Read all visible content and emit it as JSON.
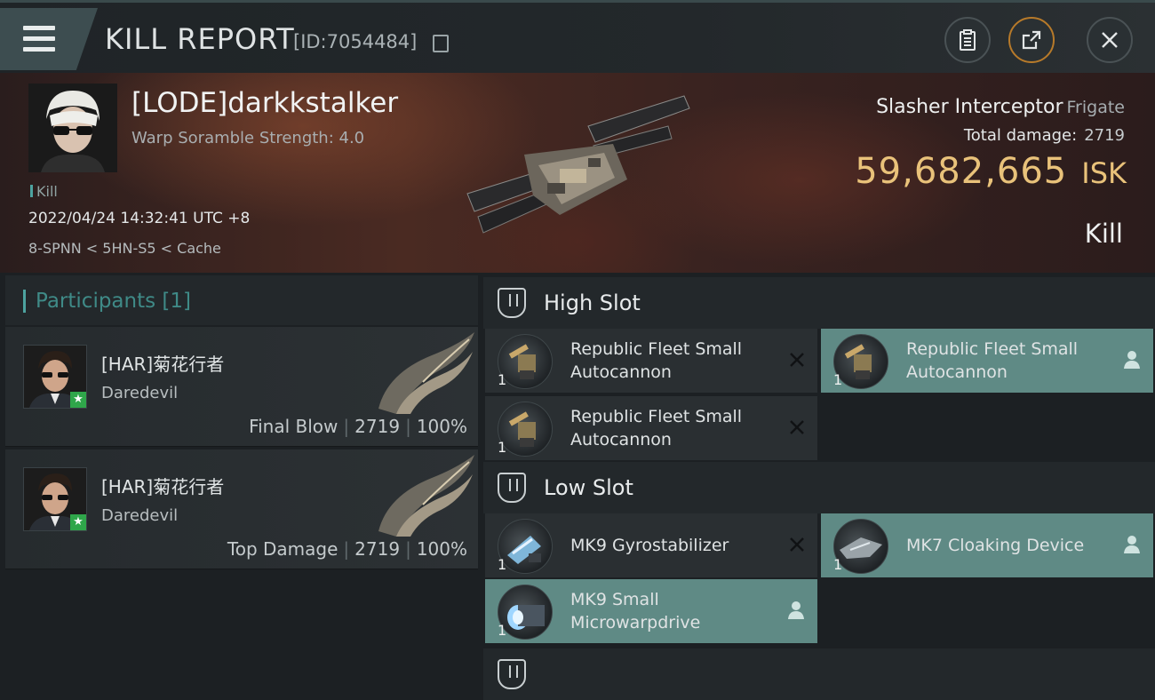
{
  "topbar": {
    "title": "KILL REPORT",
    "report_id": "[ID:7054484]",
    "buttons": [
      "clipboard-icon",
      "share-icon",
      "close-icon"
    ]
  },
  "victim": {
    "name": "[LODE]darkkstalker",
    "scramble": "Warp Soramble Strength: 4.0",
    "tag": "Kill",
    "datetime": "2022/04/24 14:32:41 UTC +8",
    "location": "8-SPNN < 5HN-S5 < Cache",
    "ship_name": "Slasher Interceptor",
    "ship_class": "Frigate",
    "total_damage_label": "Total damage:",
    "total_damage": "2719",
    "isk_value": "59,682,665",
    "isk_unit": "ISK",
    "result": "Kill"
  },
  "participants": {
    "title": "Participants [1]",
    "list": [
      {
        "name": "[HAR]菊花行者",
        "ship": "Daredevil",
        "role": "Final Blow",
        "damage": "2719",
        "percent": "100%"
      },
      {
        "name": "[HAR]菊花行者",
        "ship": "Daredevil",
        "role": "Top Damage",
        "damage": "2719",
        "percent": "100%"
      }
    ]
  },
  "slots": {
    "high": {
      "title": "High Slot",
      "items": [
        {
          "name": "Republic Fleet Small Autocannon",
          "qty": "1",
          "status": "destroyed"
        },
        {
          "name": "Republic Fleet Small Autocannon",
          "qty": "1",
          "status": "dropped"
        },
        {
          "name": "Republic Fleet Small Autocannon",
          "qty": "1",
          "status": "destroyed"
        }
      ]
    },
    "low": {
      "title": "Low Slot",
      "items": [
        {
          "name": "MK9 Gyrostabilizer",
          "qty": "1",
          "status": "destroyed"
        },
        {
          "name": "MK7 Cloaking Device",
          "qty": "1",
          "status": "dropped"
        },
        {
          "name": "MK9 Small Microwarpdrive",
          "qty": "1",
          "status": "dropped"
        }
      ]
    }
  },
  "colors": {
    "accent_teal": "#4da3a0",
    "isk_gold": "#e9c27a",
    "dropped_bg": "#5f8a85"
  }
}
